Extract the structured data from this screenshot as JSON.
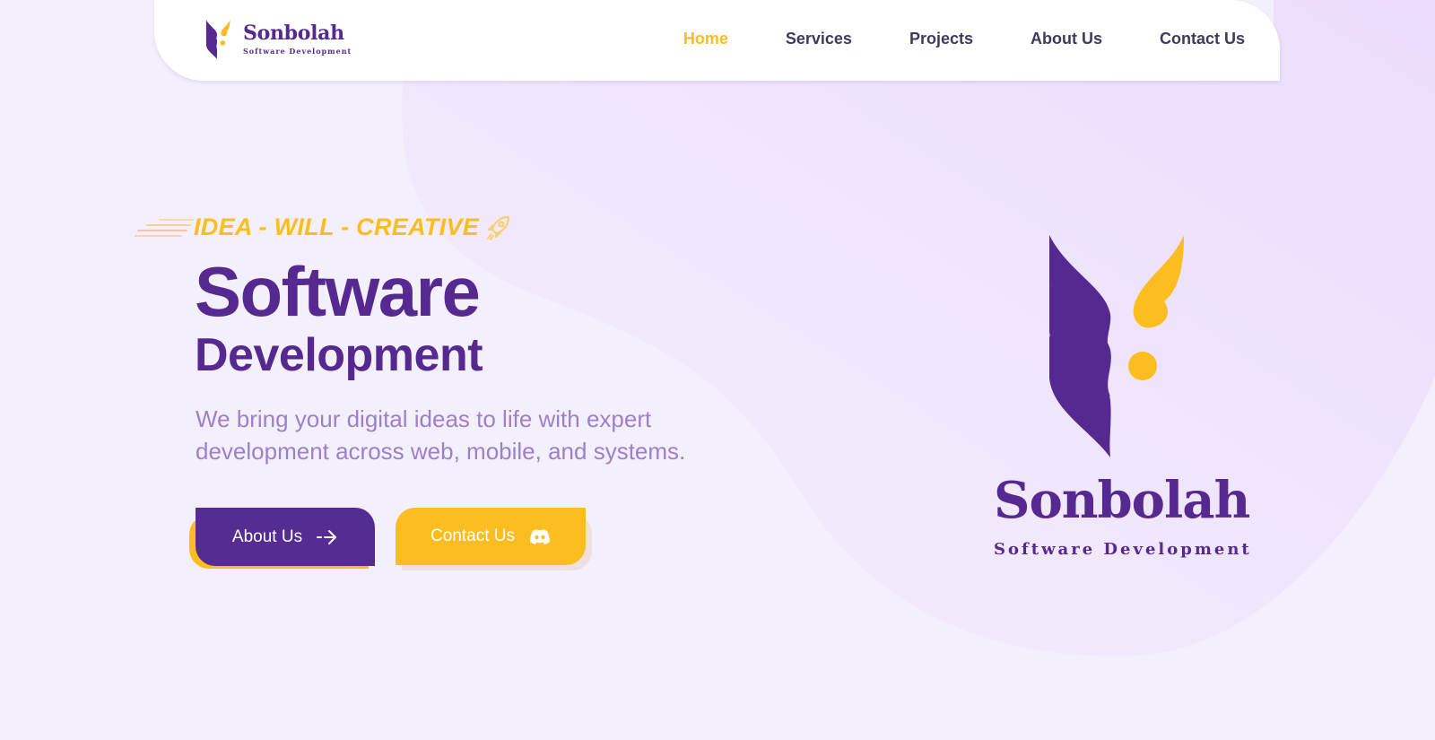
{
  "colors": {
    "primary_purple": "#55298f",
    "accent_yellow": "#fbbd1f",
    "nav_text": "#3f3a5c",
    "description_text": "#9c80c8",
    "background": "#f4effc"
  },
  "header": {
    "logo_icon": "sonbolah-wheat-logo-icon",
    "brand_name": "Sonbolah",
    "brand_subtitle": "Software Development",
    "nav": [
      {
        "label": "Home",
        "active": true
      },
      {
        "label": "Services",
        "active": false
      },
      {
        "label": "Projects",
        "active": false
      },
      {
        "label": "About Us",
        "active": false
      },
      {
        "label": "Contact Us",
        "active": false
      }
    ]
  },
  "hero": {
    "tagline": "IDEA - WILL - CREATIVE",
    "tagline_icon": "rocket-icon",
    "title": "Software",
    "subtitle": "Development",
    "description": "We bring your digital ideas to life with expert development across web, mobile, and systems.",
    "buttons": {
      "about": {
        "label": "About Us",
        "icon": "arrow-right-icon"
      },
      "contact": {
        "label": "Contact Us",
        "icon": "discord-icon"
      }
    }
  },
  "showcase": {
    "logo_icon": "sonbolah-wheat-logo-icon",
    "brand_name": "Sonbolah",
    "brand_subtitle": "Software Development"
  }
}
